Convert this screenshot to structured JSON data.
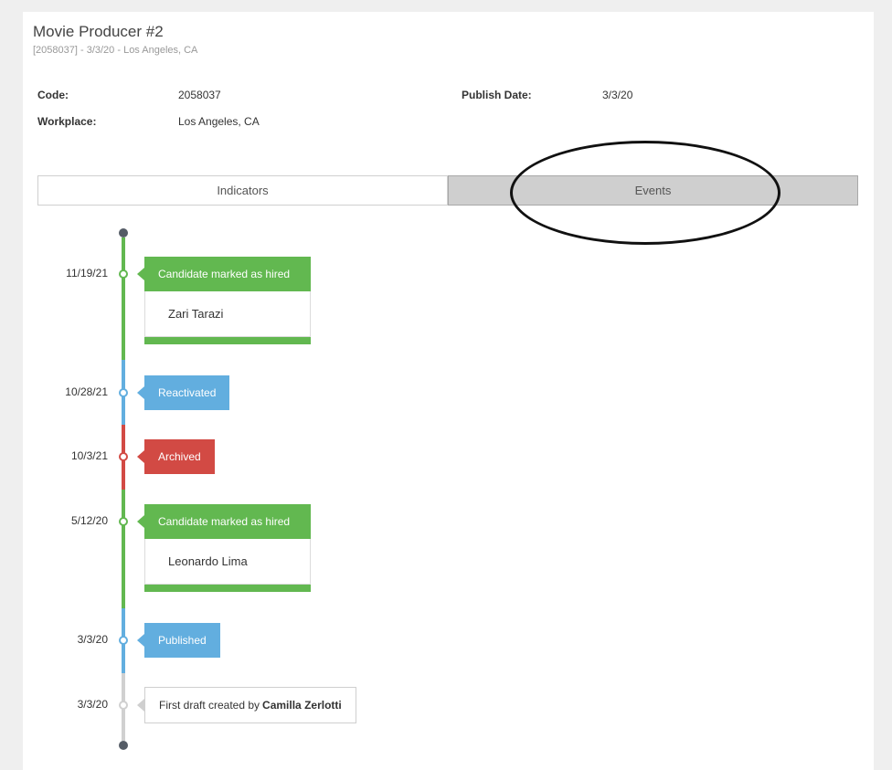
{
  "job": {
    "title": "Movie Producer #2",
    "subtitle": "[2058037] - 3/3/20 - Los Angeles, CA"
  },
  "details": {
    "code_label": "Code:",
    "code_value": "2058037",
    "workplace_label": "Workplace:",
    "workplace_value": "Los Angeles, CA",
    "publish_label": "Publish Date:",
    "publish_value": "3/3/20"
  },
  "tabs": {
    "indicators": "Indicators",
    "events": "Events",
    "active": "events"
  },
  "timeline": [
    {
      "date": "11/19/21",
      "title": "Candidate marked as hired",
      "detail": "Zari Tarazi",
      "status": "green"
    },
    {
      "date": "10/28/21",
      "title": "Reactivated",
      "status": "blue"
    },
    {
      "date": "10/3/21",
      "title": "Archived",
      "status": "red"
    },
    {
      "date": "5/12/20",
      "title": "Candidate marked as hired",
      "detail": "Leonardo Lima",
      "status": "green"
    },
    {
      "date": "3/3/20",
      "title": "Published",
      "status": "blue"
    },
    {
      "date": "3/3/20",
      "title": "First draft created by",
      "actor": "Camilla Zerlotti",
      "status": "gray"
    }
  ],
  "colors": {
    "green": "#62b850",
    "blue": "#62aedf",
    "red": "#d24a44",
    "gray": "#d0d0d0",
    "tab_active": "#cfcfcf"
  }
}
